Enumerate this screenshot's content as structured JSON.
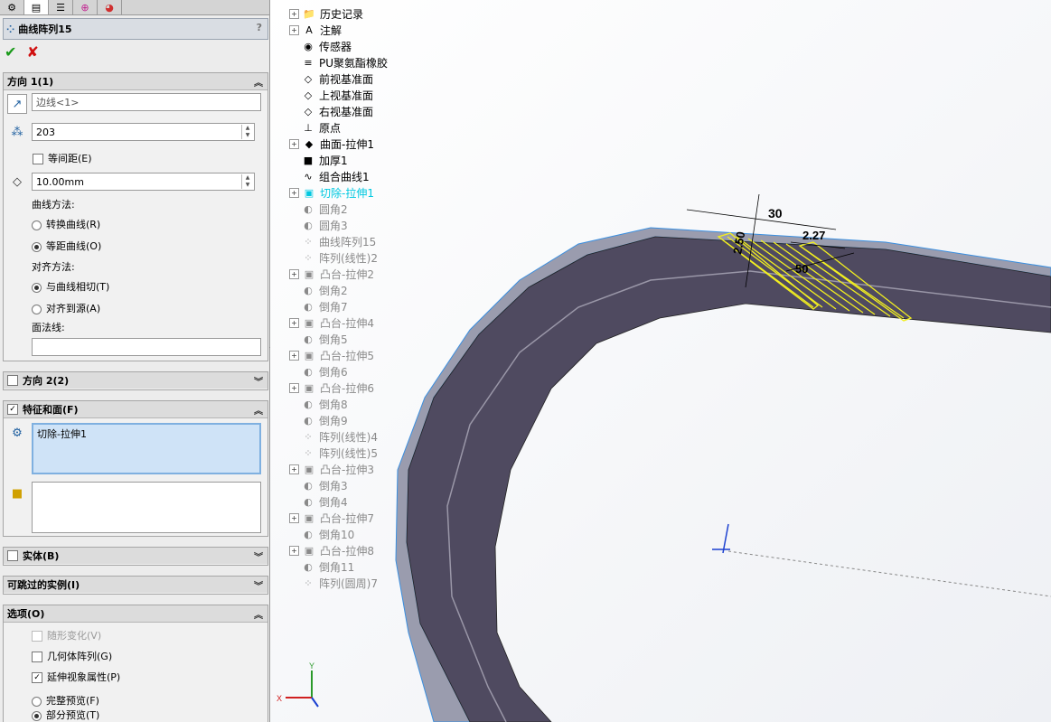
{
  "property_manager": {
    "feature_title": "曲线阵列15",
    "help": "?",
    "ok_icon": "✔",
    "cancel_icon": "✘",
    "direction1": {
      "header": "方向 1(1)",
      "edge_value": "边线<1>",
      "instances": "203",
      "equal_spacing_label": "等间距(E)",
      "spacing": "10.00mm",
      "curve_method_label": "曲线方法:",
      "curve_opt1": "转换曲线(R)",
      "curve_opt2": "等距曲线(O)",
      "align_method_label": "对齐方法:",
      "align_opt1": "与曲线相切(T)",
      "align_opt2": "对齐到源(A)",
      "face_normal_label": "面法线:"
    },
    "direction2": {
      "header": "方向 2(2)"
    },
    "features_faces": {
      "header": "特征和面(F)",
      "feature_item": "切除-拉伸1"
    },
    "bodies": {
      "header": "实体(B)"
    },
    "skip": {
      "header": "可跳过的实例(I)"
    },
    "options": {
      "header": "选项(O)",
      "opt1": "随形变化(V)",
      "opt2": "几何体阵列(G)",
      "opt3": "延伸视象属性(P)",
      "opt4": "完整预览(F)",
      "opt5": "部分预览(T)"
    }
  },
  "tree": [
    {
      "label": "历史记录",
      "style": "normal",
      "exp": true,
      "icon": "📁"
    },
    {
      "label": "注解",
      "style": "normal",
      "exp": true,
      "icon": "A"
    },
    {
      "label": "传感器",
      "style": "normal",
      "exp": false,
      "icon": "◉"
    },
    {
      "label": "PU聚氨酯橡胶",
      "style": "normal",
      "exp": false,
      "icon": "≡"
    },
    {
      "label": "前视基准面",
      "style": "normal",
      "exp": false,
      "icon": "◇"
    },
    {
      "label": "上视基准面",
      "style": "normal",
      "exp": false,
      "icon": "◇"
    },
    {
      "label": "右视基准面",
      "style": "normal",
      "exp": false,
      "icon": "◇"
    },
    {
      "label": "原点",
      "style": "normal",
      "exp": false,
      "icon": "⊥"
    },
    {
      "label": "曲面-拉伸1",
      "style": "normal",
      "exp": true,
      "icon": "◆"
    },
    {
      "label": "加厚1",
      "style": "normal",
      "exp": false,
      "icon": "■"
    },
    {
      "label": "组合曲线1",
      "style": "normal",
      "exp": false,
      "icon": "∿"
    },
    {
      "label": "切除-拉伸1",
      "style": "cyan",
      "exp": true,
      "icon": "▣"
    },
    {
      "label": "圆角2",
      "style": "grey",
      "exp": false,
      "icon": "◐"
    },
    {
      "label": "圆角3",
      "style": "grey",
      "exp": false,
      "icon": "◐"
    },
    {
      "label": "曲线阵列15",
      "style": "grey",
      "exp": false,
      "icon": "⁘"
    },
    {
      "label": "阵列(线性)2",
      "style": "grey",
      "exp": false,
      "icon": "⁘"
    },
    {
      "label": "凸台-拉伸2",
      "style": "grey",
      "exp": true,
      "icon": "▣"
    },
    {
      "label": "倒角2",
      "style": "grey",
      "exp": false,
      "icon": "◐"
    },
    {
      "label": "倒角7",
      "style": "grey",
      "exp": false,
      "icon": "◐"
    },
    {
      "label": "凸台-拉伸4",
      "style": "grey",
      "exp": true,
      "icon": "▣"
    },
    {
      "label": "倒角5",
      "style": "grey",
      "exp": false,
      "icon": "◐"
    },
    {
      "label": "凸台-拉伸5",
      "style": "grey",
      "exp": true,
      "icon": "▣"
    },
    {
      "label": "倒角6",
      "style": "grey",
      "exp": false,
      "icon": "◐"
    },
    {
      "label": "凸台-拉伸6",
      "style": "grey",
      "exp": true,
      "icon": "▣"
    },
    {
      "label": "倒角8",
      "style": "grey",
      "exp": false,
      "icon": "◐"
    },
    {
      "label": "倒角9",
      "style": "grey",
      "exp": false,
      "icon": "◐"
    },
    {
      "label": "阵列(线性)4",
      "style": "grey",
      "exp": false,
      "icon": "⁘"
    },
    {
      "label": "阵列(线性)5",
      "style": "grey",
      "exp": false,
      "icon": "⁘"
    },
    {
      "label": "凸台-拉伸3",
      "style": "grey",
      "exp": true,
      "icon": "▣"
    },
    {
      "label": "倒角3",
      "style": "grey",
      "exp": false,
      "icon": "◐"
    },
    {
      "label": "倒角4",
      "style": "grey",
      "exp": false,
      "icon": "◐"
    },
    {
      "label": "凸台-拉伸7",
      "style": "grey",
      "exp": true,
      "icon": "▣"
    },
    {
      "label": "倒角10",
      "style": "grey",
      "exp": false,
      "icon": "◐"
    },
    {
      "label": "凸台-拉伸8",
      "style": "grey",
      "exp": true,
      "icon": "▣"
    },
    {
      "label": "倒角11",
      "style": "grey",
      "exp": false,
      "icon": "◐"
    },
    {
      "label": "阵列(圆周)7",
      "style": "grey",
      "exp": false,
      "icon": "⁘"
    }
  ],
  "viewport": {
    "dim_30": "30",
    "dim_250": "2.50",
    "dim_227": "2.27",
    "dim_50": "50",
    "triad_x": "X",
    "triad_y": "Y",
    "body_color": "#4f4a60",
    "edge_color": "#3a8fe0",
    "preview_color": "#f2ef20"
  }
}
